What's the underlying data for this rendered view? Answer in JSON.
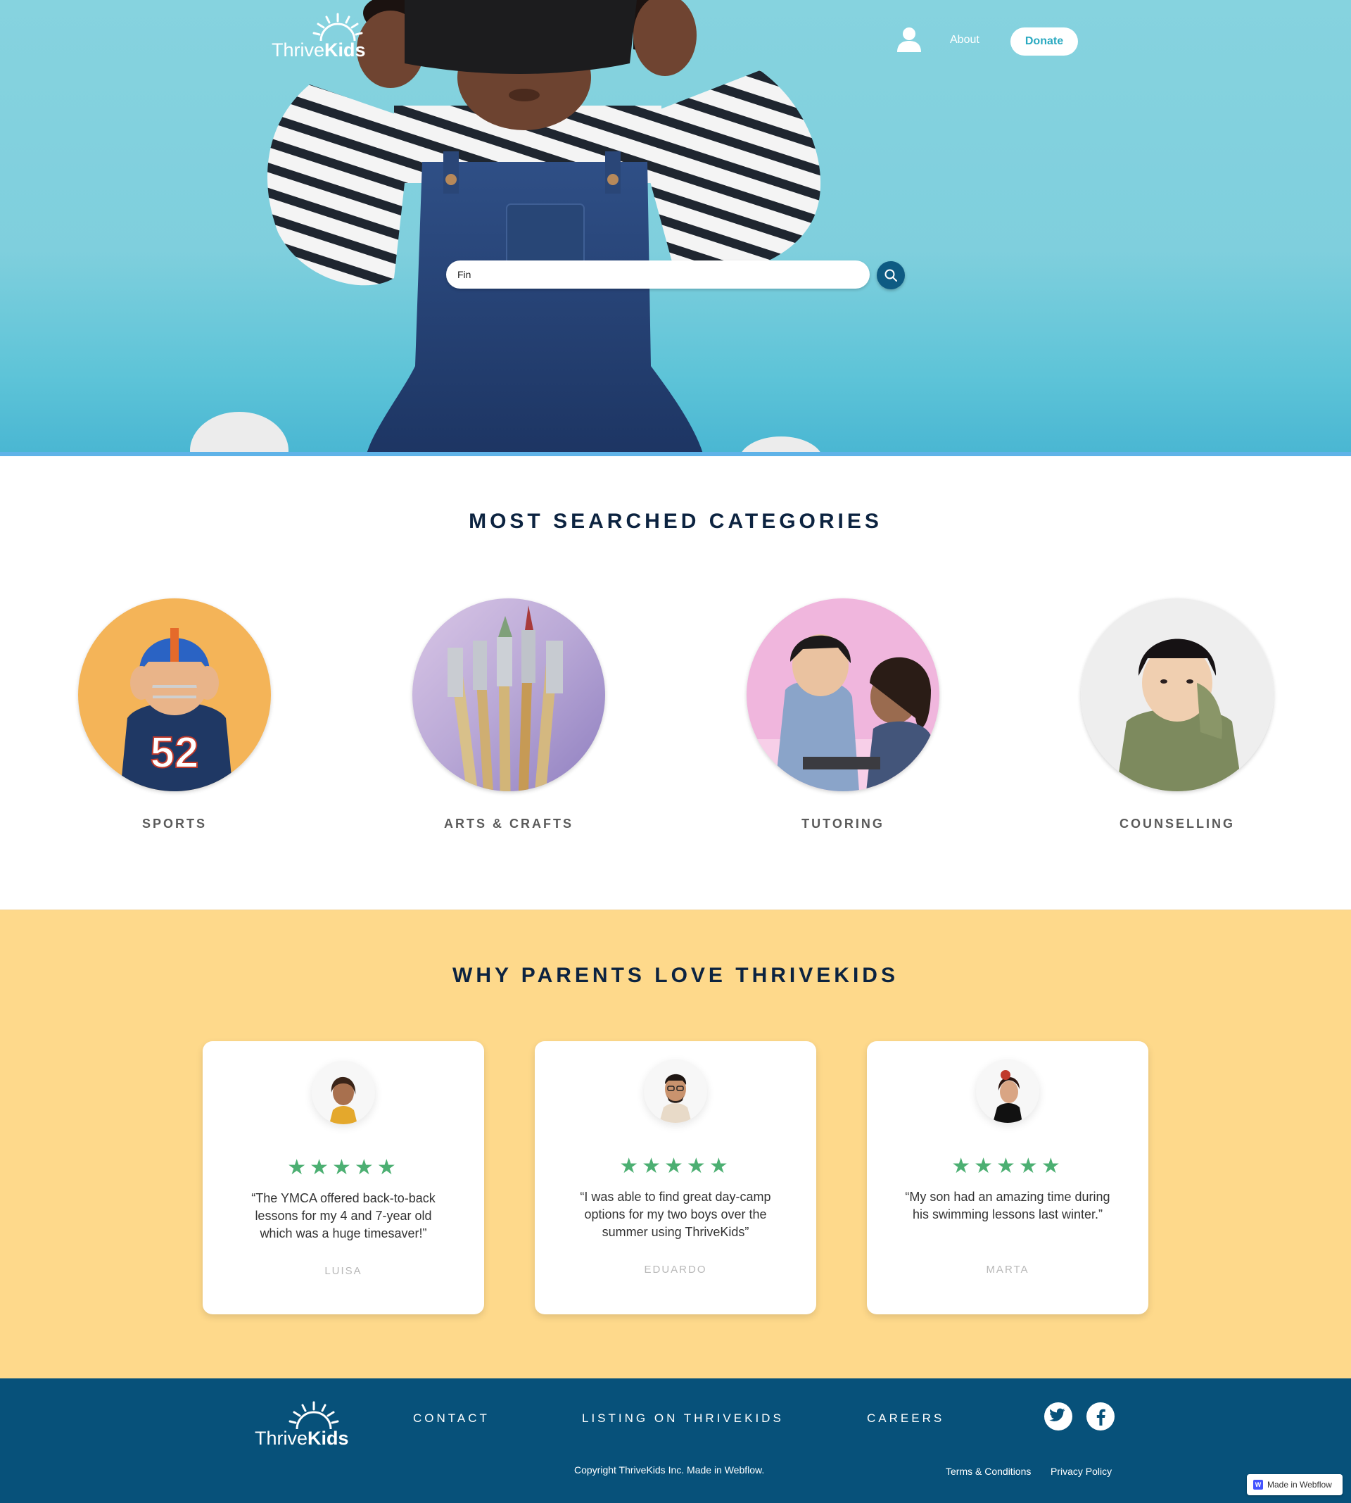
{
  "brand": {
    "name_regular": "Thrive",
    "name_bold": "Kids"
  },
  "nav": {
    "about_label": "About",
    "donate_label": "Donate"
  },
  "search": {
    "value": "Fin"
  },
  "categories": {
    "title": "MOST SEARCHED CATEGORIES",
    "items": [
      {
        "label": "SPORTS"
      },
      {
        "label": "ARTS & CRAFTS"
      },
      {
        "label": "TUTORING"
      },
      {
        "label": "COUNSELLING"
      }
    ]
  },
  "testimonials": {
    "title": "WHY PARENTS LOVE THRIVEKIDS",
    "items": [
      {
        "stars": "★★★★★",
        "quote": "“The YMCA offered back-to-back lessons for my 4 and 7-year old which was a huge timesaver!”",
        "name": "LUISA"
      },
      {
        "stars": "★★★★★",
        "quote": "“I was able to find great day-camp options for my two boys over the summer using ThriveKids”",
        "name": "EDUARDO"
      },
      {
        "stars": "★★★★★",
        "quote": "“My son had an amazing time during his swimming lessons last winter.”",
        "name": "MARTA"
      }
    ]
  },
  "footer": {
    "links": [
      "CONTACT",
      "LISTING ON THRIVEKIDS",
      "CAREERS"
    ],
    "copyright": "Copyright ThriveKids Inc. Made in Webflow.",
    "terms": "Terms & Conditions",
    "privacy": "Privacy Policy",
    "social_icons": [
      "twitter-icon",
      "facebook-icon"
    ]
  },
  "badge": {
    "label": "Made in Webflow"
  },
  "colors": {
    "hero_bg": "#86d3df",
    "primary_dark": "#0c2340",
    "accent_teal": "#29a9c0",
    "search_button": "#0e5b83",
    "testimonials_bg": "#fed98b",
    "star_green": "#4caf72",
    "footer_bg": "#07517a"
  }
}
